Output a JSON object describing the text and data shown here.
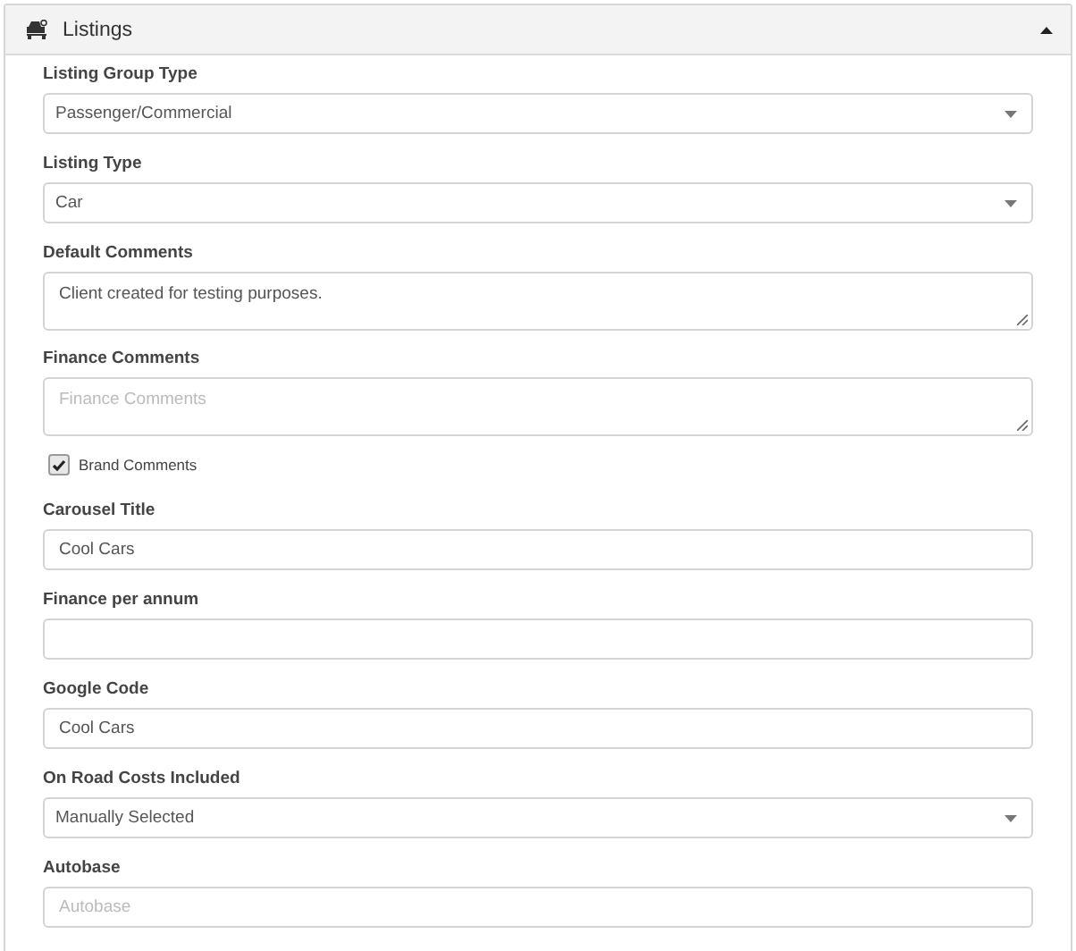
{
  "panel": {
    "title": "Listings",
    "expanded": true
  },
  "fields": [
    {
      "kind": "select",
      "label": "Listing Group Type",
      "value": "Passenger/Commercial"
    },
    {
      "kind": "select",
      "label": "Listing Type",
      "value": "Car"
    },
    {
      "kind": "textarea",
      "label": "Default Comments",
      "value": "Client created for testing purposes."
    },
    {
      "kind": "textarea",
      "label": "Finance Comments",
      "placeholder": "Finance Comments"
    },
    {
      "kind": "checkbox",
      "label": "Brand Comments",
      "checked": true
    },
    {
      "kind": "text",
      "label": "Carousel Title",
      "value": "Cool Cars"
    },
    {
      "kind": "text",
      "label": "Finance per annum"
    },
    {
      "kind": "text",
      "label": "Google Code",
      "value": "Cool Cars"
    },
    {
      "kind": "select",
      "label": "On Road Costs Included",
      "value": "Manually Selected"
    },
    {
      "kind": "text",
      "label": "Autobase",
      "placeholder": "Autobase"
    }
  ]
}
